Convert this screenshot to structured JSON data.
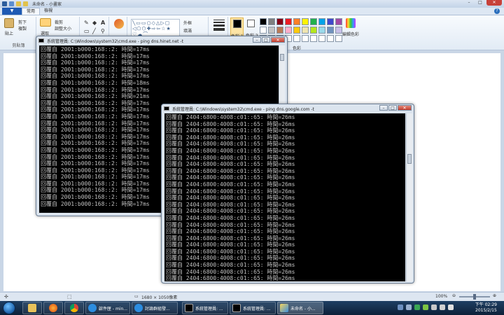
{
  "paint": {
    "title": "未命名 - 小畫家",
    "file_tab": "▼",
    "tabs": [
      "常用",
      "檢視"
    ],
    "help": "?",
    "ribbon": {
      "clipboard": {
        "paste": "貼上",
        "cut": "剪下",
        "copy": "複製",
        "label": "剪貼簿"
      },
      "image": {
        "select": "選取",
        "crop": "裁剪",
        "resize": "調整大小",
        "label": "影像"
      },
      "tools": {
        "label": "工具"
      },
      "brushes": {
        "label": "筆刷"
      },
      "shapes": {
        "outline": "外框",
        "fill": "填滿",
        "label": "圖形"
      },
      "size": {
        "label": "大小"
      },
      "color1": "色彩 1",
      "color2": "色彩 2",
      "colors_label": "色彩",
      "edit_colors": "編輯色彩",
      "palette": [
        "#000000",
        "#7f7f7f",
        "#880015",
        "#ed1c24",
        "#ff7f27",
        "#fff200",
        "#22b14c",
        "#00a2e8",
        "#3f48cc",
        "#a349a4",
        "#ffffff",
        "#c3c3c3",
        "#b97a57",
        "#ffaec9",
        "#ffc90e",
        "#efe4b0",
        "#b5e61d",
        "#99d9ea",
        "#7092be",
        "#c8bfe7",
        "#ffffff",
        "#ffffff",
        "#ffffff",
        "#ffffff",
        "#ffffff",
        "#ffffff",
        "#ffffff",
        "#ffffff",
        "#ffffff",
        "#ffffff"
      ]
    },
    "status": {
      "dimensions": "1680 × 1050像素",
      "zoom": "100%"
    }
  },
  "cmd1": {
    "title": "系統管理員: C:\\Windows\\system32\\cmd.exe - ping  dns.hinet.net -t",
    "lines": [
      "回覆自 2001:b000:168::2: 時間=17ms",
      "回覆自 2001:b000:168::2: 時間=17ms",
      "回覆自 2001:b000:168::2: 時間=17ms",
      "回覆自 2001:b000:168::2: 時間=17ms",
      "回覆自 2001:b000:168::2: 時間=17ms",
      "回覆自 2001:b000:168::2: 時間=18ms",
      "回覆自 2001:b000:168::2: 時間=17ms",
      "回覆自 2001:b000:168::2: 時間=21ms",
      "回覆自 2001:b000:168::2: 時間=17ms",
      "回覆自 2001:b000:168::2: 時間=17ms",
      "回覆自 2001:b000:168::2: 時間=17ms",
      "回覆自 2001:b000:168::2: 時間=17ms",
      "回覆自 2001:b000:168::2: 時間=17ms",
      "回覆自 2001:b000:168::2: 時間=17ms",
      "回覆自 2001:b000:168::2: 時間=17ms",
      "回覆自 2001:b000:168::2: 時間=17ms",
      "回覆自 2001:b000:168::2: 時間=17ms",
      "回覆自 2001:b000:168::2: 時間=17ms",
      "回覆自 2001:b000:168::2: 時間=17ms",
      "回覆自 2001:b000:168::2: 時間=17ms",
      "回覆自 2001:b000:168::2: 時間=17ms",
      "回覆自 2001:b000:168::2: 時間=17ms",
      "回覆自 2001:b000:168::2: 時間=17ms",
      "回覆自 2001:b000:168::2: 時間=17ms"
    ]
  },
  "cmd2": {
    "title": "系統管理員: C:\\Windows\\system32\\cmd.exe - ping  dns.google.com -t",
    "lines": [
      "回覆自 2404:6800:4008:c01::65: 時間=26ms",
      "回覆自 2404:6800:4008:c01::65: 時間=26ms",
      "回覆自 2404:6800:4008:c01::65: 時間=26ms",
      "回覆自 2404:6800:4008:c01::65: 時間=26ms",
      "回覆自 2404:6800:4008:c01::65: 時間=26ms",
      "回覆自 2404:6800:4008:c01::65: 時間=26ms",
      "回覆自 2404:6800:4008:c01::65: 時間=26ms",
      "回覆自 2404:6800:4008:c01::65: 時間=26ms",
      "回覆自 2404:6800:4008:c01::65: 時間=26ms",
      "回覆自 2404:6800:4008:c01::65: 時間=26ms",
      "回覆自 2404:6800:4008:c01::65: 時間=26ms",
      "回覆自 2404:6800:4008:c01::65: 時間=26ms",
      "回覆自 2404:6800:4008:c01::65: 時間=26ms",
      "回覆自 2404:6800:4008:c01::65: 時間=26ms",
      "回覆自 2404:6800:4008:c01::65: 時間=26ms",
      "回覆自 2404:6800:4008:c01::65: 時間=26ms",
      "回覆自 2404:6800:4008:c01::65: 時間=26ms",
      "回覆自 2404:6800:4008:c01::65: 時間=26ms",
      "回覆自 2404:6800:4008:c01::65: 時間=26ms",
      "回覆自 2404:6800:4008:c01::65: 時間=26ms",
      "回覆自 2404:6800:4008:c01::65: 時間=26ms",
      "回覆自 2404:6800:4008:c01::65: 時間=26ms",
      "回覆自 2404:6800:4008:c01::65: 時間=26ms",
      "回覆自 2404:6800:4008:c01::65: 時間=26ms",
      "回覆自 2404:6800:4008:c01::65: 時間=26ms"
    ]
  },
  "taskbar": {
    "items": [
      {
        "label": "",
        "icon": "folder-icon"
      },
      {
        "label": "",
        "icon": "firefox-icon"
      },
      {
        "label": "",
        "icon": "chrome-icon"
      },
      {
        "label": "啟件匣 - min...",
        "icon": "ie-icon"
      },
      {
        "label": "討論群組發...",
        "icon": "ie-icon"
      },
      {
        "label": "系統管理員: ...",
        "icon": "cmd-icon"
      },
      {
        "label": "系統管理員: ...",
        "icon": "cmd-icon"
      },
      {
        "label": "未命名 - 小...",
        "icon": "paint-icon"
      }
    ],
    "time": "下午 02:29",
    "date": "2015/2/15"
  },
  "colors": {
    "cmd_bg": "#000000",
    "cmd_text": "#c0c0c0",
    "taskbar": "#14304f",
    "ribbon": "#eaf0f8"
  }
}
